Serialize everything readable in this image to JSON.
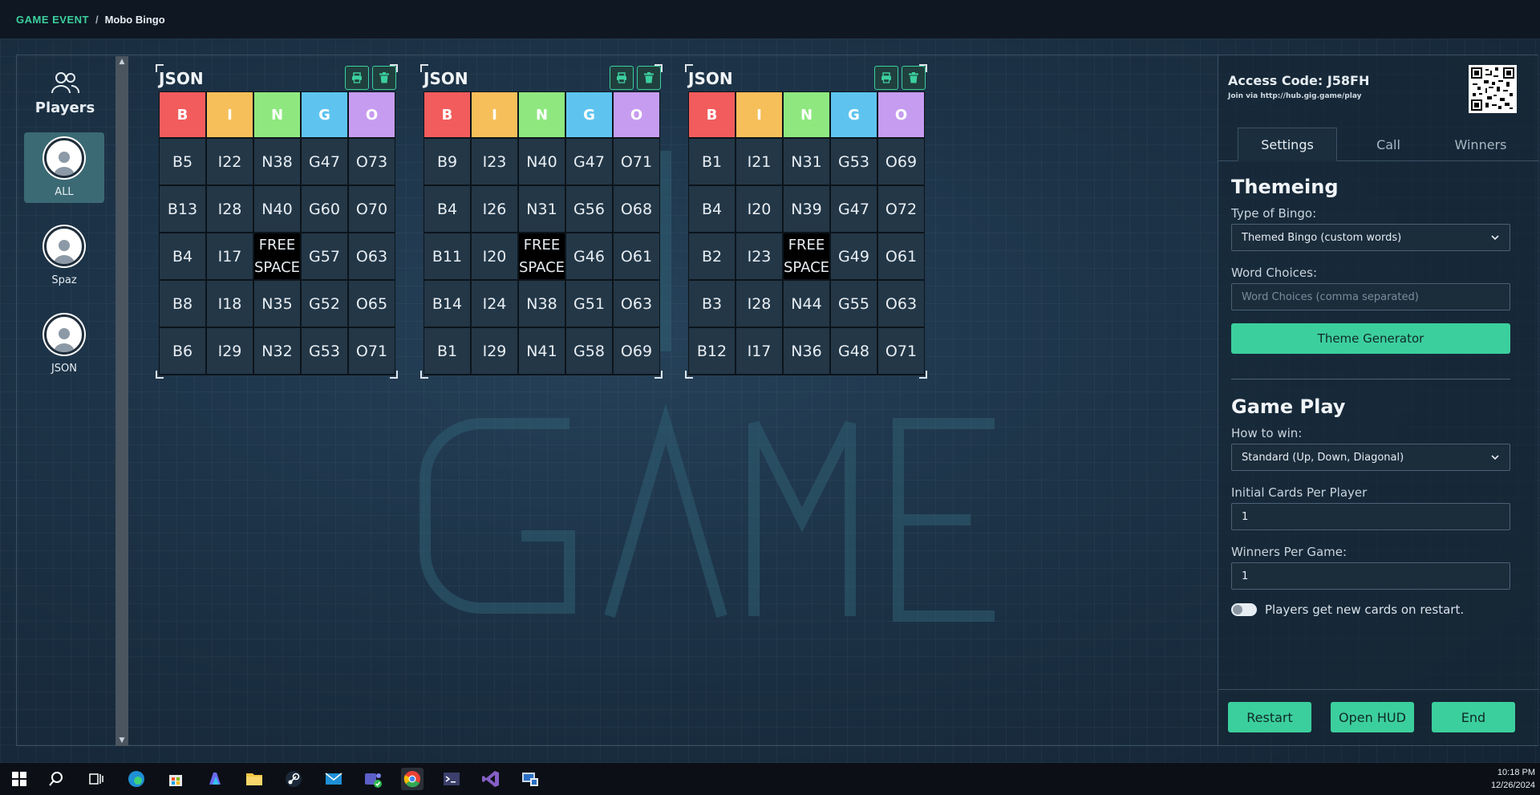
{
  "breadcrumb": {
    "section": "GAME EVENT",
    "separator": "/",
    "page": "Mobo Bingo"
  },
  "players_panel": {
    "title": "Players",
    "players": [
      {
        "name": "ALL",
        "active": true
      },
      {
        "name": "Spaz",
        "active": false
      },
      {
        "name": "JSON",
        "active": false
      }
    ]
  },
  "bingo_header": {
    "letters": [
      "B",
      "I",
      "N",
      "G",
      "O"
    ],
    "colors": [
      "#f25c5c",
      "#f7bf5a",
      "#8ee87f",
      "#5ec4ef",
      "#c69cf0"
    ]
  },
  "cards": [
    {
      "title": "JSON",
      "rows": [
        [
          "B5",
          "I22",
          "N38",
          "G47",
          "O73"
        ],
        [
          "B13",
          "I28",
          "N40",
          "G60",
          "O70"
        ],
        [
          "B4",
          "I17",
          "FREE SPACE",
          "G57",
          "O63"
        ],
        [
          "B8",
          "I18",
          "N35",
          "G52",
          "O65"
        ],
        [
          "B6",
          "I29",
          "N32",
          "G53",
          "O71"
        ]
      ]
    },
    {
      "title": "JSON",
      "rows": [
        [
          "B9",
          "I23",
          "N40",
          "G47",
          "O71"
        ],
        [
          "B4",
          "I26",
          "N31",
          "G56",
          "O68"
        ],
        [
          "B11",
          "I20",
          "FREE SPACE",
          "G46",
          "O61"
        ],
        [
          "B14",
          "I24",
          "N38",
          "G51",
          "O63"
        ],
        [
          "B1",
          "I29",
          "N41",
          "G58",
          "O69"
        ]
      ]
    },
    {
      "title": "JSON",
      "rows": [
        [
          "B1",
          "I21",
          "N31",
          "G53",
          "O69"
        ],
        [
          "B4",
          "I20",
          "N39",
          "G47",
          "O72"
        ],
        [
          "B2",
          "I23",
          "FREE SPACE",
          "G49",
          "O61"
        ],
        [
          "B3",
          "I28",
          "N44",
          "G55",
          "O63"
        ],
        [
          "B12",
          "I17",
          "N36",
          "G48",
          "O71"
        ]
      ]
    }
  ],
  "free_space": {
    "line1": "FREE",
    "line2": "SPACE"
  },
  "access": {
    "code": "Access Code: J58FH",
    "join": "Join via http://hub.gig.game/play"
  },
  "tabs": [
    "Settings",
    "Call",
    "Winners"
  ],
  "themeing": {
    "title": "Themeing",
    "type_label": "Type of Bingo:",
    "type_value": "Themed Bingo (custom words)",
    "words_label": "Word Choices:",
    "words_placeholder": "Word Choices (comma separated)",
    "generator_button": "Theme Generator"
  },
  "gameplay": {
    "title": "Game Play",
    "win_label": "How to win:",
    "win_value": "Standard (Up, Down, Diagonal)",
    "cards_label": "Initial Cards Per Player",
    "cards_value": "1",
    "winners_label": "Winners Per Game:",
    "winners_value": "1",
    "toggle_label": "Players get new cards on restart.",
    "toggle_on": false
  },
  "actions": [
    "Restart",
    "Open HUD",
    "End"
  ],
  "taskbar": {
    "apps": [
      "windows-start",
      "search",
      "task-view",
      "edge",
      "store",
      "copilot",
      "file-explorer",
      "steam",
      "mail",
      "teams",
      "chrome",
      "terminal",
      "visual-studio",
      "remote-desktop"
    ],
    "time": "10:18 PM",
    "date": "12/26/2024"
  },
  "colors": {
    "accent": "#3ccf9e",
    "free_cell": "#000000",
    "cell": "#233747"
  }
}
